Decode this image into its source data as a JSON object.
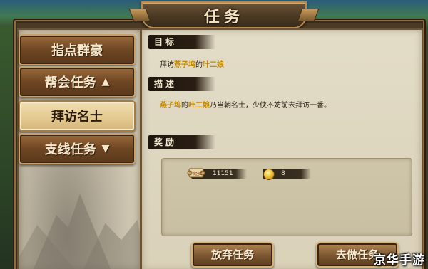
{
  "window": {
    "title": "任务"
  },
  "nav": {
    "items": [
      {
        "label": "指点群豪",
        "arrow": ""
      },
      {
        "label": "帮会任务",
        "arrow": "▲"
      },
      {
        "label": "拜访名士",
        "arrow": ""
      },
      {
        "label": "支线任务",
        "arrow": "▼"
      }
    ],
    "selected": "拜访名士"
  },
  "quest": {
    "goal_title": "目标",
    "goal_prefix": "拜访",
    "goal_place": "燕子坞",
    "goal_mid": "的",
    "goal_npc": "叶二娘",
    "desc_title": "描述",
    "desc_place": "燕子坞",
    "desc_mid": "的",
    "desc_npc": "叶二娘",
    "desc_rest": "乃当朝名士，少侠不妨前去拜访一番。",
    "reward_title": "奖励"
  },
  "rewards": {
    "exp_label": "经验",
    "exp_value": "11151",
    "gold_value": "8"
  },
  "buttons": {
    "abandon": "放弃任务",
    "goto": "去做任务"
  },
  "watermark": "京华手游",
  "colors": {
    "highlight": "#c28a00",
    "panel_bg": "#e3dcc7",
    "button": "#7b5530"
  }
}
